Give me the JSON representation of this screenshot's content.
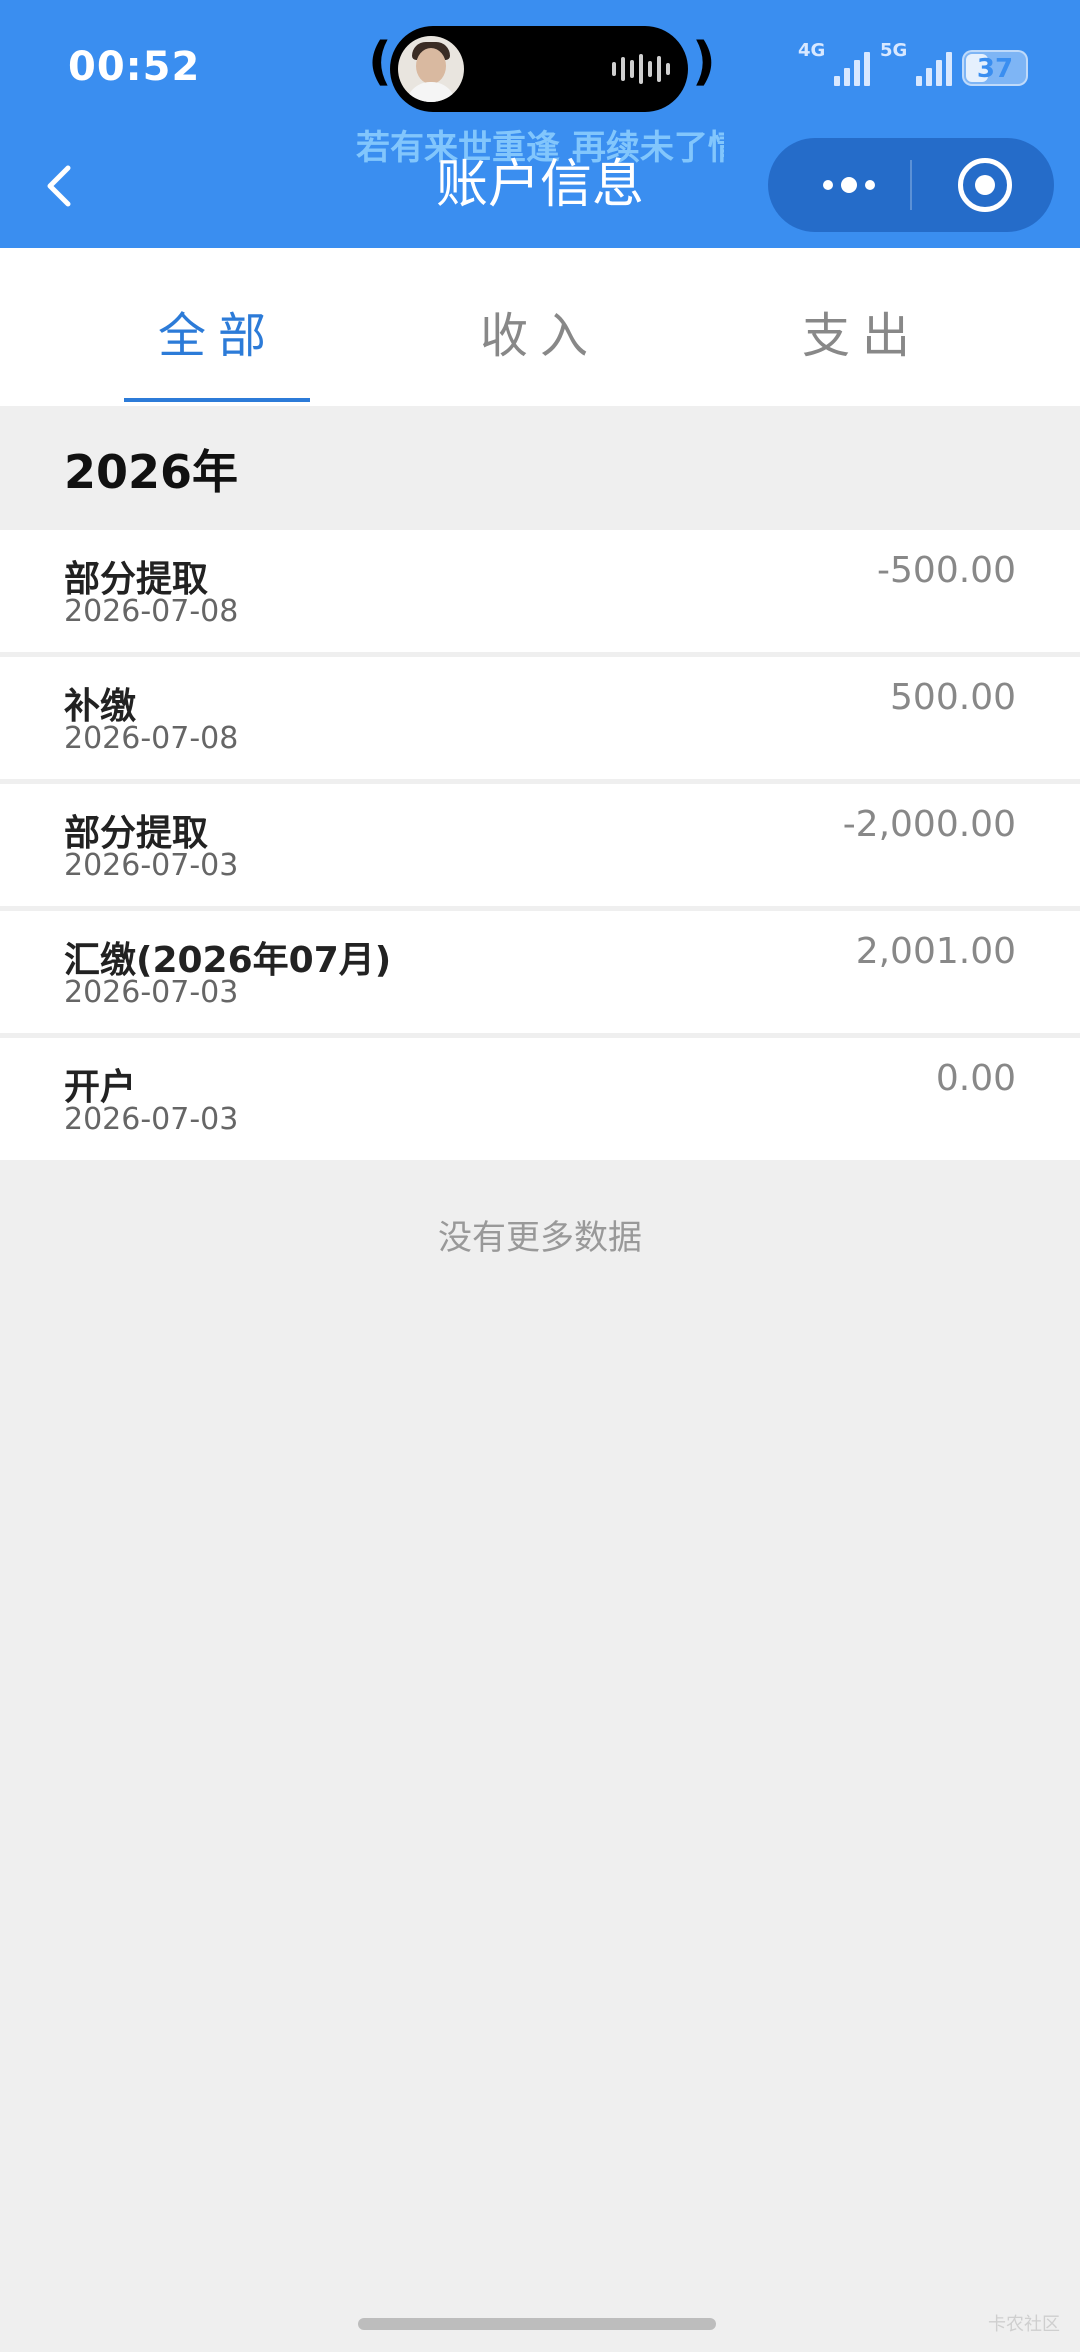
{
  "status_bar": {
    "time": "00:52",
    "net1_label": "4G",
    "net2_label": "5G",
    "battery_level": "37"
  },
  "media_banner": {
    "lyric": "若有来世重逢 再续未了情"
  },
  "nav": {
    "title": "账户信息"
  },
  "tabs": [
    {
      "label": "全部",
      "active": true
    },
    {
      "label": "收入",
      "active": false
    },
    {
      "label": "支出",
      "active": false
    }
  ],
  "year_header": "2026年",
  "records": [
    {
      "name": "部分提取",
      "date": "2026-07-08",
      "amount": "-500.00"
    },
    {
      "name": "补缴",
      "date": "2026-07-08",
      "amount": "500.00"
    },
    {
      "name": "部分提取",
      "date": "2026-07-03",
      "amount": "-2,000.00"
    },
    {
      "name": "汇缴(2026年07月)",
      "date": "2026-07-03",
      "amount": "2,001.00"
    },
    {
      "name": "开户",
      "date": "2026-07-03",
      "amount": "0.00"
    }
  ],
  "footer_text": "没有更多数据",
  "watermark": "卡农社区",
  "colors": {
    "header_blue": "#3a8ef0",
    "tab_active": "#2c7bd8",
    "background": "#efefef"
  }
}
